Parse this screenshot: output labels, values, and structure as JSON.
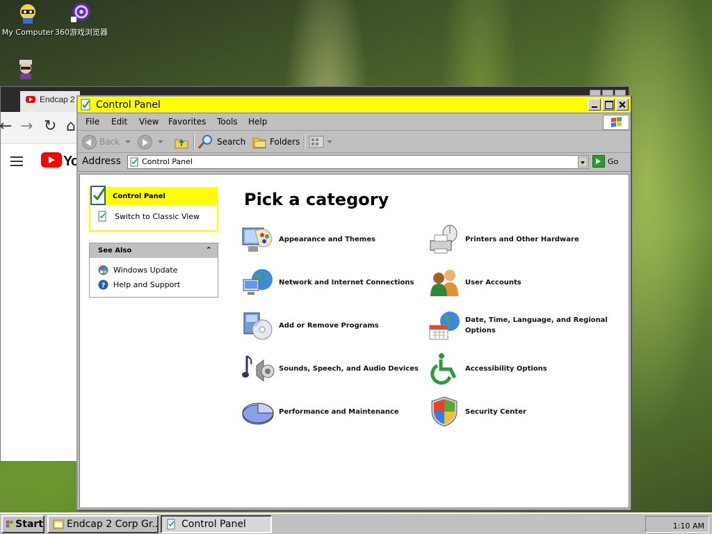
{
  "desktop": {
    "icons": [
      {
        "label": "My Computer"
      },
      {
        "label": "360游戏浏览器"
      },
      {
        "label": ""
      }
    ]
  },
  "background_window": {
    "tab_title": "Endcap 2",
    "youtube_word": "You"
  },
  "window": {
    "title": "Control Panel",
    "menu": [
      "File",
      "Edit",
      "View",
      "Favorites",
      "Tools",
      "Help"
    ],
    "toolbar": {
      "back": "Back",
      "search": "Search",
      "folders": "Folders"
    },
    "address": {
      "label": "Address",
      "value": "Control Panel",
      "go": "Go"
    }
  },
  "sidebar": {
    "control_panel": {
      "title": "Control Panel",
      "switch_link": "Switch to Classic View"
    },
    "see_also": {
      "title": "See Also",
      "links": [
        "Windows Update",
        "Help and Support"
      ]
    }
  },
  "main": {
    "heading": "Pick a category",
    "categories": [
      {
        "label": "Appearance and Themes",
        "icon": "appearance-themes-icon"
      },
      {
        "label": "Printers and Other Hardware",
        "icon": "printers-hardware-icon"
      },
      {
        "label": "Network and Internet Connections",
        "icon": "network-icon"
      },
      {
        "label": "User Accounts",
        "icon": "user-accounts-icon"
      },
      {
        "label": "Add or Remove Programs",
        "icon": "add-remove-programs-icon"
      },
      {
        "label": "Date, Time, Language, and Regional Options",
        "icon": "date-time-icon"
      },
      {
        "label": "Sounds, Speech, and Audio Devices",
        "icon": "sounds-icon"
      },
      {
        "label": "Accessibility Options",
        "icon": "accessibility-icon"
      },
      {
        "label": "Performance and Maintenance",
        "icon": "performance-icon"
      },
      {
        "label": "Security Center",
        "icon": "security-center-icon"
      }
    ]
  },
  "taskbar": {
    "start": "Start",
    "tasks": [
      "Endcap 2 Corp Gr...",
      "Control Panel"
    ],
    "clock": "1:10 AM"
  },
  "colors": {
    "titlebar": "#ffff00",
    "chrome": "#c0c0c0"
  }
}
